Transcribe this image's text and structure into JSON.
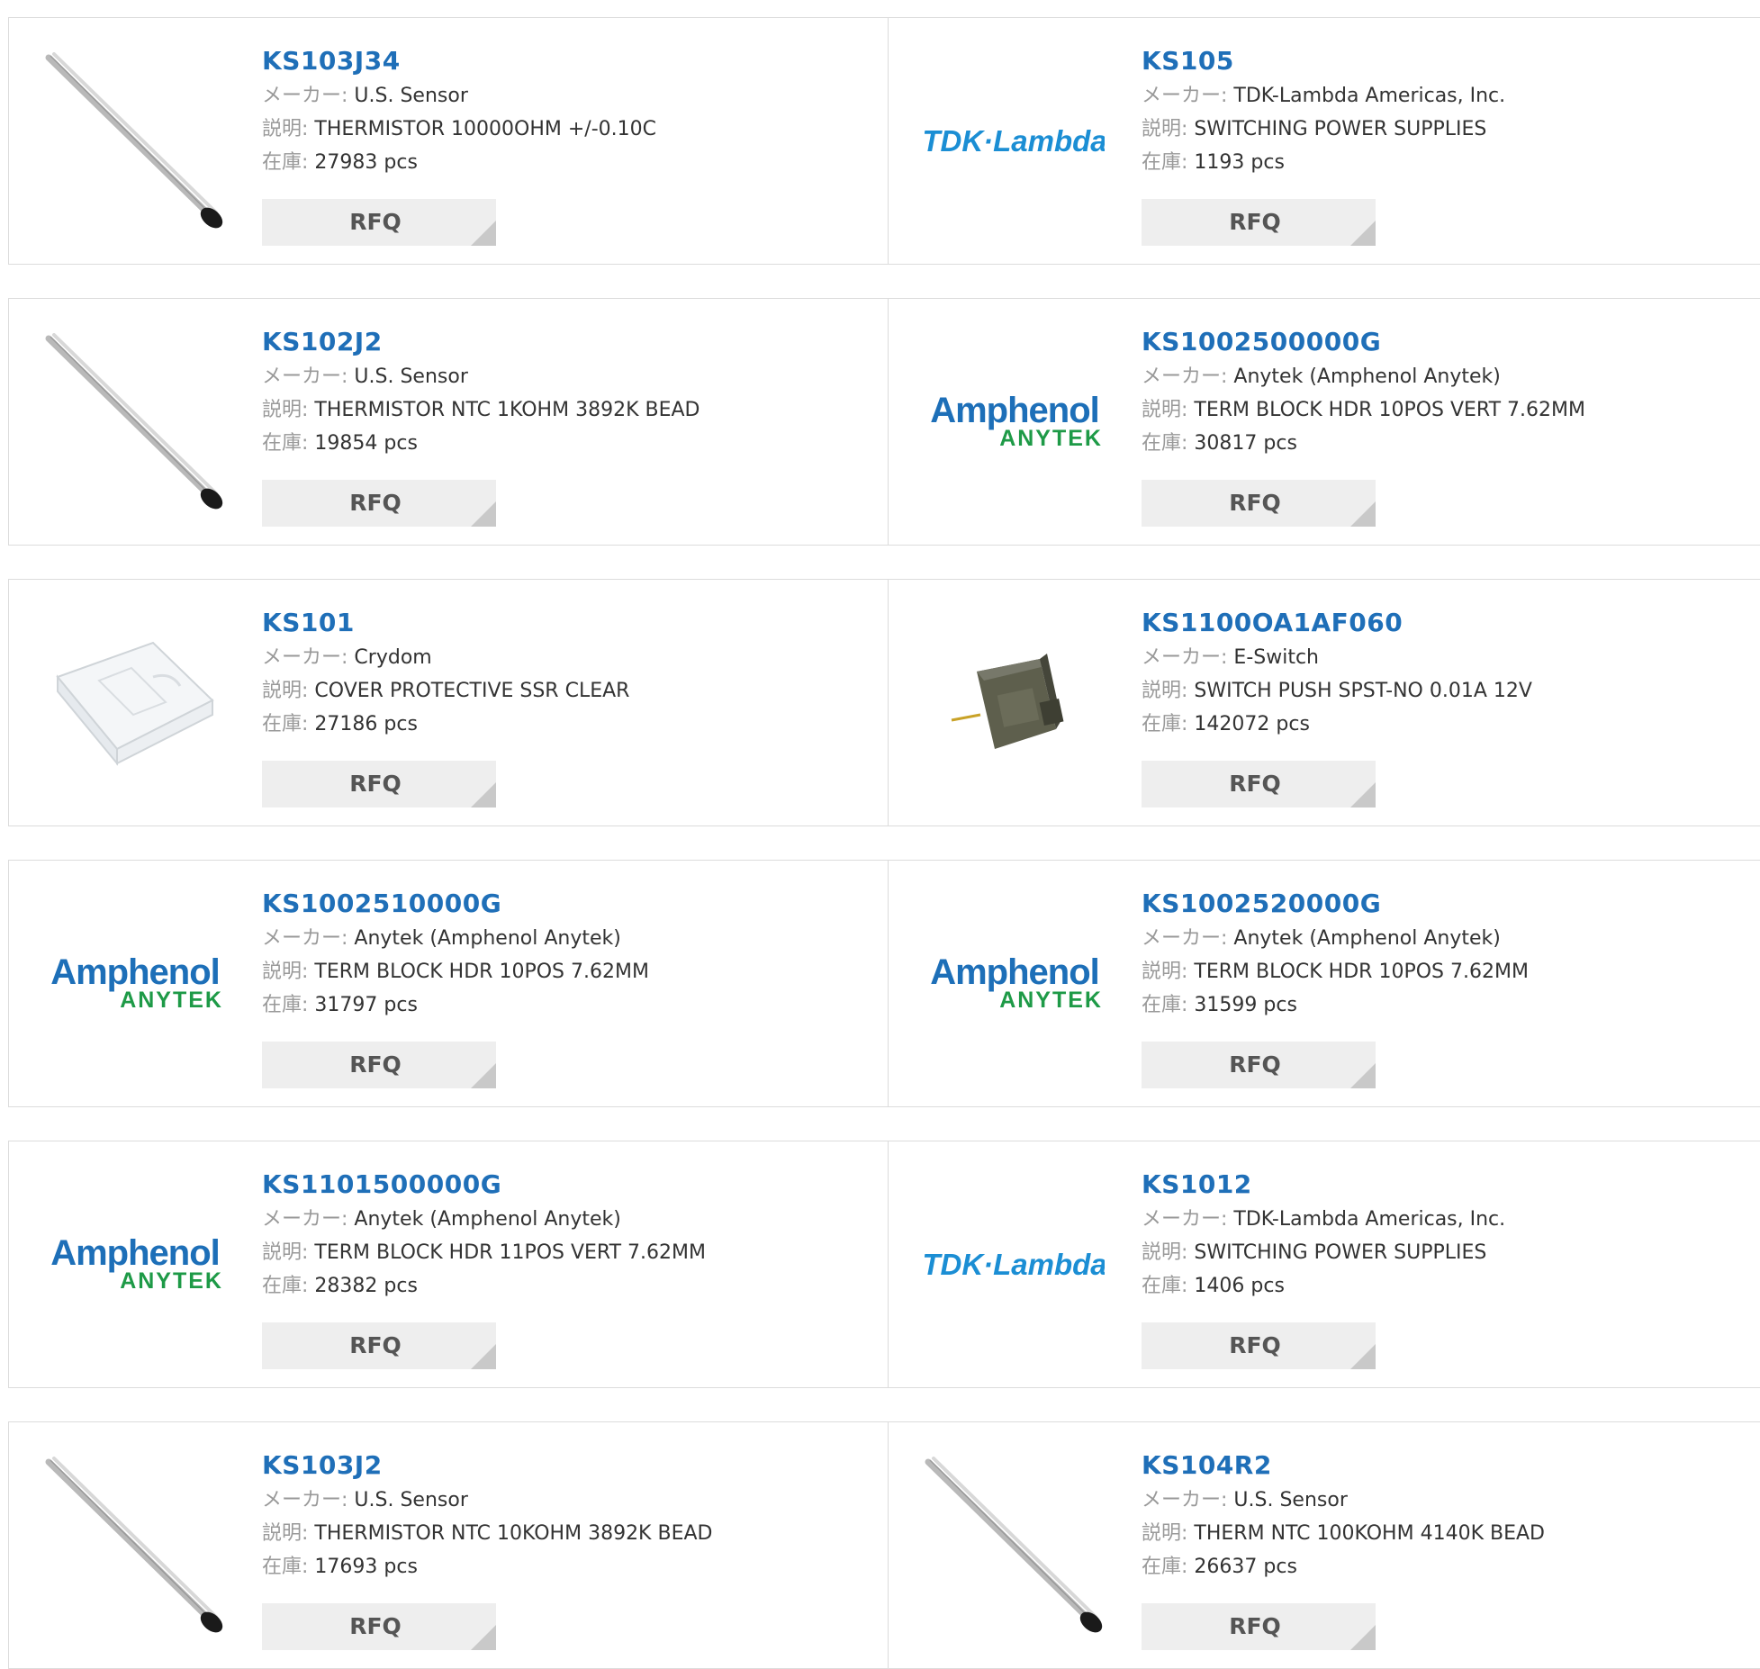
{
  "labels": {
    "maker": "メーカー:",
    "desc": "説明:",
    "stock": "在庫:",
    "rfq": "RFQ"
  },
  "products": [
    {
      "pn": "KS103J34",
      "maker": "U.S. Sensor",
      "desc": "THERMISTOR 10000OHM +/-0.10C",
      "stock": "27983 pcs",
      "image": "thermistor-probe"
    },
    {
      "pn": "KS105",
      "maker": "TDK-Lambda Americas, Inc.",
      "desc": "SWITCHING POWER SUPPLIES",
      "stock": "1193 pcs",
      "image": "tdk-lambda-logo"
    },
    {
      "pn": "KS102J2",
      "maker": "U.S. Sensor",
      "desc": "THERMISTOR NTC 1KOHM 3892K BEAD",
      "stock": "19854 pcs",
      "image": "thermistor-probe"
    },
    {
      "pn": "KS1002500000G",
      "maker": "Anytek (Amphenol Anytek)",
      "desc": "TERM BLOCK HDR 10POS VERT 7.62MM",
      "stock": "30817 pcs",
      "image": "amphenol-anytek-logo"
    },
    {
      "pn": "KS101",
      "maker": "Crydom",
      "desc": "COVER PROTECTIVE SSR CLEAR",
      "stock": "27186 pcs",
      "image": "clear-cover"
    },
    {
      "pn": "KS1100OA1AF060",
      "maker": "E-Switch",
      "desc": "SWITCH PUSH SPST-NO 0.01A 12V",
      "stock": "142072 pcs",
      "image": "push-switch"
    },
    {
      "pn": "KS1002510000G",
      "maker": "Anytek (Amphenol Anytek)",
      "desc": "TERM BLOCK HDR 10POS 7.62MM",
      "stock": "31797 pcs",
      "image": "amphenol-anytek-logo"
    },
    {
      "pn": "KS1002520000G",
      "maker": "Anytek (Amphenol Anytek)",
      "desc": "TERM BLOCK HDR 10POS 7.62MM",
      "stock": "31599 pcs",
      "image": "amphenol-anytek-logo"
    },
    {
      "pn": "KS1101500000G",
      "maker": "Anytek (Amphenol Anytek)",
      "desc": "TERM BLOCK HDR 11POS VERT 7.62MM",
      "stock": "28382 pcs",
      "image": "amphenol-anytek-logo"
    },
    {
      "pn": "KS1012",
      "maker": "TDK-Lambda Americas, Inc.",
      "desc": "SWITCHING POWER SUPPLIES",
      "stock": "1406 pcs",
      "image": "tdk-lambda-logo"
    },
    {
      "pn": "KS103J2",
      "maker": "U.S. Sensor",
      "desc": "THERMISTOR NTC 10KOHM 3892K BEAD",
      "stock": "17693 pcs",
      "image": "thermistor-probe"
    },
    {
      "pn": "KS104R2",
      "maker": "U.S. Sensor",
      "desc": "THERM NTC 100KOHM 4140K BEAD",
      "stock": "26637 pcs",
      "image": "thermistor-probe"
    }
  ],
  "logo_text": {
    "tdk": "TDK·Lambda",
    "amphenol": "Amphenol",
    "anytek": "ANYTEK"
  },
  "colors": {
    "link": "#1f6fb8",
    "tdk": "#1b8ed4",
    "amphenol": "#1d6fb8",
    "anytek": "#1e9a47",
    "rfq_bg": "#eeeeee"
  }
}
